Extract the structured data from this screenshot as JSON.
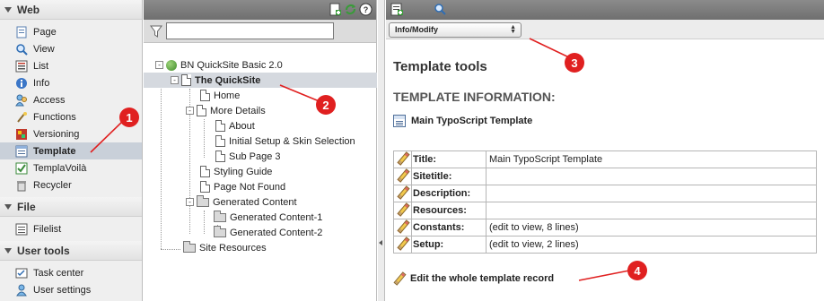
{
  "module_menu": {
    "groups": [
      {
        "title": "Web",
        "items": [
          {
            "label": "Page",
            "icon": "page-icon"
          },
          {
            "label": "View",
            "icon": "view-icon"
          },
          {
            "label": "List",
            "icon": "list-icon"
          },
          {
            "label": "Info",
            "icon": "info-icon"
          },
          {
            "label": "Access",
            "icon": "access-icon"
          },
          {
            "label": "Functions",
            "icon": "functions-icon"
          },
          {
            "label": "Versioning",
            "icon": "versioning-icon"
          },
          {
            "label": "Template",
            "icon": "template-icon",
            "active": true
          },
          {
            "label": "TemplaVoilà",
            "icon": "templavoila-icon"
          },
          {
            "label": "Recycler",
            "icon": "recycler-icon"
          }
        ]
      },
      {
        "title": "File",
        "items": [
          {
            "label": "Filelist",
            "icon": "filelist-icon"
          }
        ]
      },
      {
        "title": "User tools",
        "items": [
          {
            "label": "Task center",
            "icon": "task-center-icon"
          },
          {
            "label": "User settings",
            "icon": "user-settings-icon"
          }
        ]
      }
    ]
  },
  "page_tree": {
    "filter_value": "",
    "nodes": [
      {
        "label": "BN QuickSite Basic 2.0",
        "kind": "root"
      },
      {
        "label": "The QuickSite",
        "kind": "page",
        "selected": true
      },
      {
        "label": "Home",
        "kind": "page"
      },
      {
        "label": "More Details",
        "kind": "page"
      },
      {
        "label": "About",
        "kind": "page"
      },
      {
        "label": "Initial Setup & Skin Selection",
        "kind": "page"
      },
      {
        "label": "Sub Page 3",
        "kind": "page"
      },
      {
        "label": "Styling Guide",
        "kind": "page"
      },
      {
        "label": "Page Not Found",
        "kind": "page"
      },
      {
        "label": "Generated Content",
        "kind": "folder"
      },
      {
        "label": "Generated Content-1",
        "kind": "folder"
      },
      {
        "label": "Generated Content-2",
        "kind": "folder"
      },
      {
        "label": "Site Resources",
        "kind": "folder"
      }
    ]
  },
  "content": {
    "function_select": "Info/Modify",
    "page_title": "Template tools",
    "section_heading": "TEMPLATE INFORMATION:",
    "template_link": "Main TypoScript Template",
    "properties": [
      {
        "key": "Title:",
        "value": "Main TypoScript Template"
      },
      {
        "key": "Sitetitle:",
        "value": ""
      },
      {
        "key": "Description:",
        "value": ""
      },
      {
        "key": "Resources:",
        "value": ""
      },
      {
        "key": "Constants:",
        "value": "(edit to view, 8 lines)"
      },
      {
        "key": "Setup:",
        "value": "(edit to view, 2 lines)"
      }
    ],
    "edit_whole_label": "Edit the whole template record"
  },
  "callouts": [
    "1",
    "2",
    "3",
    "4"
  ],
  "colors": {
    "callout": "#e02020",
    "selected_row": "#d5d9df",
    "active_module": "#c9d0d9"
  }
}
